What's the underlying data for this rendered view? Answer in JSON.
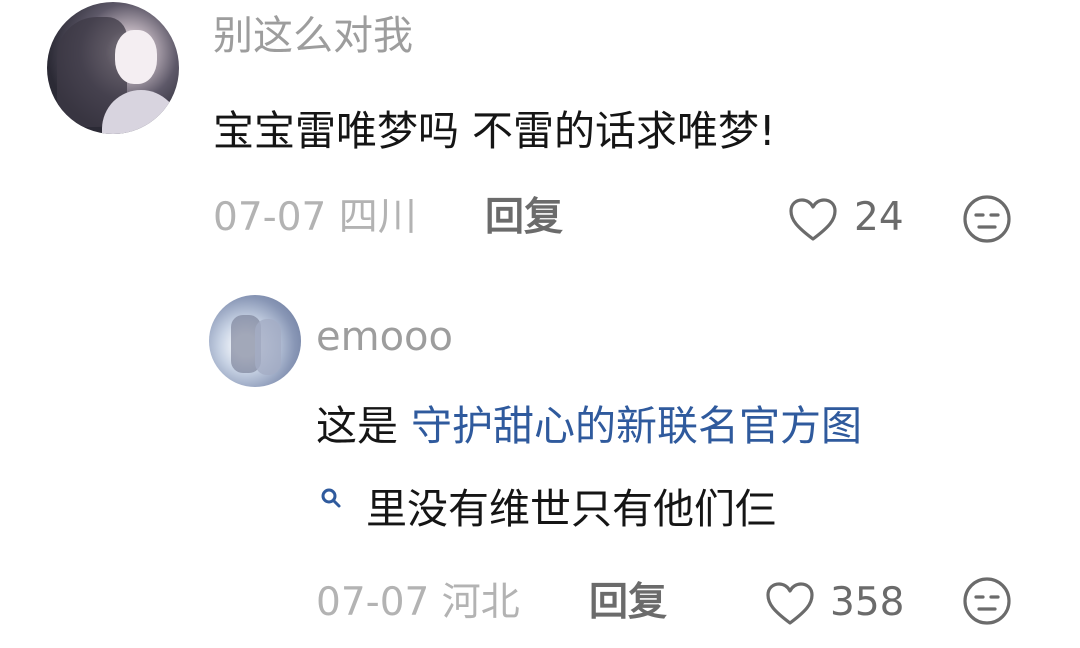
{
  "comments": [
    {
      "username": "别这么对我",
      "text": "宝宝雷唯梦吗 不雷的话求唯梦!",
      "date": "07-07",
      "location": "四川",
      "reply_label": "回复",
      "likes": "24"
    },
    {
      "username": "emooo",
      "text_prefix": "这是 ",
      "link_text": "守护甜心的新联名官方图",
      "text_suffix": "里没有维世只有他们仨",
      "date": "07-07",
      "location": "河北",
      "reply_label": "回复",
      "likes": "358"
    }
  ],
  "icons": {
    "like": "heart-outline-icon",
    "dislike": "neutral-face-icon",
    "link_search": "search-icon"
  },
  "colors": {
    "link": "#2f5a9d",
    "meta": "#b3b3b3",
    "action": "#6b6b6b"
  }
}
